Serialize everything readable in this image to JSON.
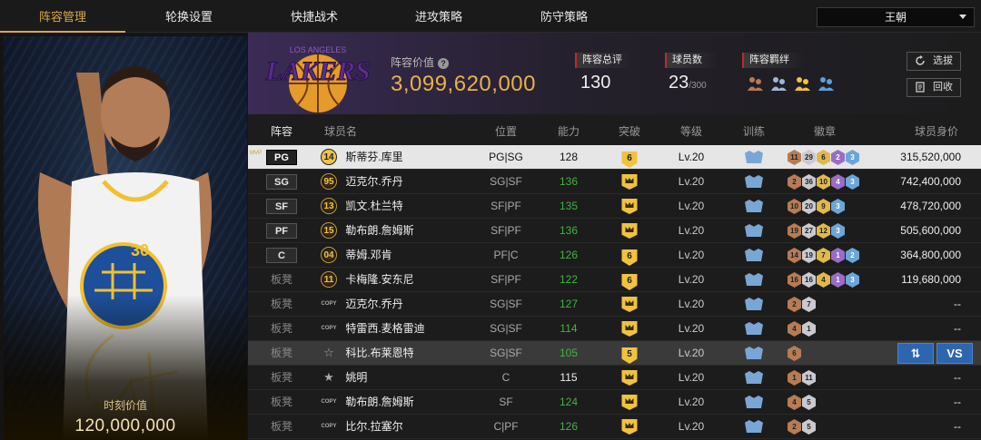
{
  "tabs": [
    {
      "label": "阵容管理",
      "active": true
    },
    {
      "label": "轮换设置",
      "active": false
    },
    {
      "label": "快捷战术",
      "active": false
    },
    {
      "label": "进攻策略",
      "active": false
    },
    {
      "label": "防守策略",
      "active": false
    }
  ],
  "team_select": {
    "value": "王朝"
  },
  "card": {
    "jersey": "30",
    "team_text": "GOLDEN STATE WARRIORS",
    "label": "时刻价值",
    "value": "120,000,000"
  },
  "header": {
    "lineup_value_label": "阵容价值",
    "lineup_value": "3,099,620,000",
    "logo_text": "LAKERS",
    "logo_top_text": "LOS ANGELES",
    "stats": [
      {
        "label": "阵容总评",
        "value": "130"
      },
      {
        "label": "球员数",
        "value": "23",
        "suffix": "/300"
      },
      {
        "label": "阵容羁绊",
        "value": ""
      }
    ],
    "buttons": {
      "select": "选拔",
      "recycle": "回收"
    }
  },
  "columns": [
    "阵容",
    "球员名",
    "位置",
    "能力",
    "突破",
    "等级",
    "训练",
    "徽章",
    "球员身价"
  ],
  "accent": "#d9a84a",
  "rows": [
    {
      "role": "PG",
      "tag": "MVP",
      "icon": "num",
      "num": "14",
      "name": "斯蒂芬.库里",
      "pos": "PG|SG",
      "rating": "128",
      "breakthrough": "6",
      "level": "Lv.20",
      "badges": [
        [
          "b",
          "11"
        ],
        [
          "s",
          "29"
        ],
        [
          "g",
          "6"
        ],
        [
          "p",
          "2"
        ],
        [
          "d",
          "3"
        ]
      ],
      "price": "315,520,000"
    },
    {
      "role": "SG",
      "icon": "num",
      "num": "95",
      "name": "迈克尔.乔丹",
      "pos": "SG|SF",
      "rating": "136",
      "breakthrough": "crown",
      "level": "Lv.20",
      "badges": [
        [
          "b",
          "2"
        ],
        [
          "s",
          "36"
        ],
        [
          "g",
          "10"
        ],
        [
          "p",
          "4"
        ],
        [
          "d",
          "3"
        ]
      ],
      "price": "742,400,000"
    },
    {
      "role": "SF",
      "icon": "num",
      "num": "13",
      "name": "凯文.杜兰特",
      "pos": "SF|PF",
      "rating": "135",
      "breakthrough": "crown",
      "level": "Lv.20",
      "badges": [
        [
          "b",
          "10"
        ],
        [
          "s",
          "20"
        ],
        [
          "g",
          "9"
        ],
        [
          "d",
          "3"
        ]
      ],
      "price": "478,720,000"
    },
    {
      "role": "PF",
      "icon": "num",
      "num": "15",
      "name": "勒布朗.詹姆斯",
      "pos": "SF|PF",
      "rating": "136",
      "breakthrough": "crown",
      "level": "Lv.20",
      "badges": [
        [
          "b",
          "19"
        ],
        [
          "s",
          "27"
        ],
        [
          "g",
          "12"
        ],
        [
          "d",
          "3"
        ]
      ],
      "price": "505,600,000"
    },
    {
      "role": "C",
      "icon": "num",
      "num": "04",
      "name": "蒂姆.邓肯",
      "pos": "PF|C",
      "rating": "126",
      "breakthrough": "6",
      "level": "Lv.20",
      "badges": [
        [
          "b",
          "14"
        ],
        [
          "s",
          "19"
        ],
        [
          "g",
          "7"
        ],
        [
          "p",
          "1"
        ],
        [
          "d",
          "2"
        ]
      ],
      "price": "364,800,000"
    },
    {
      "role": "板凳",
      "icon": "num",
      "num": "11",
      "name": "卡梅隆.安东尼",
      "pos": "SF|PF",
      "rating": "122",
      "breakthrough": "6",
      "level": "Lv.20",
      "badges": [
        [
          "b",
          "16"
        ],
        [
          "s",
          "16"
        ],
        [
          "g",
          "4"
        ],
        [
          "p",
          "1"
        ],
        [
          "d",
          "3"
        ]
      ],
      "price": "119,680,000"
    },
    {
      "role": "板凳",
      "icon": "copy",
      "num": "COPY",
      "name": "迈克尔.乔丹",
      "pos": "SG|SF",
      "rating": "127",
      "breakthrough": "crown",
      "level": "Lv.20",
      "badges": [
        [
          "b",
          "2"
        ],
        [
          "s",
          "7"
        ]
      ],
      "price": "--"
    },
    {
      "role": "板凳",
      "icon": "copy",
      "num": "COPY",
      "name": "特雷西.麦格雷迪",
      "pos": "SG|SF",
      "rating": "114",
      "breakthrough": "crown",
      "level": "Lv.20",
      "badges": [
        [
          "b",
          "4"
        ],
        [
          "s",
          "1"
        ]
      ],
      "price": "--"
    },
    {
      "role": "板凳",
      "icon": "star",
      "num": "☆",
      "name": "科比.布莱恩特",
      "pos": "SG|SF",
      "rating": "105",
      "breakthrough": "5",
      "level": "Lv.20",
      "badges": [
        [
          "b",
          "6"
        ]
      ],
      "price": "",
      "actions": [
        "⇅",
        "VS"
      ]
    },
    {
      "role": "板凳",
      "icon": "star",
      "num": "★",
      "name": "姚明",
      "pos": "C",
      "rating": "115",
      "breakthrough": "crown",
      "level": "Lv.20",
      "badges": [
        [
          "b",
          "1"
        ],
        [
          "s",
          "11"
        ]
      ],
      "price": "--"
    },
    {
      "role": "板凳",
      "icon": "copy",
      "num": "COPY",
      "name": "勒布朗.詹姆斯",
      "pos": "SF",
      "rating": "124",
      "breakthrough": "crown",
      "level": "Lv.20",
      "badges": [
        [
          "b",
          "4"
        ],
        [
          "s",
          "5"
        ]
      ],
      "price": "--"
    },
    {
      "role": "板凳",
      "icon": "copy",
      "num": "COPY",
      "name": "比尔.拉塞尔",
      "pos": "C|PF",
      "rating": "126",
      "breakthrough": "crown",
      "level": "Lv.20",
      "badges": [
        [
          "b",
          "2"
        ],
        [
          "s",
          "5"
        ]
      ],
      "price": "--"
    }
  ]
}
